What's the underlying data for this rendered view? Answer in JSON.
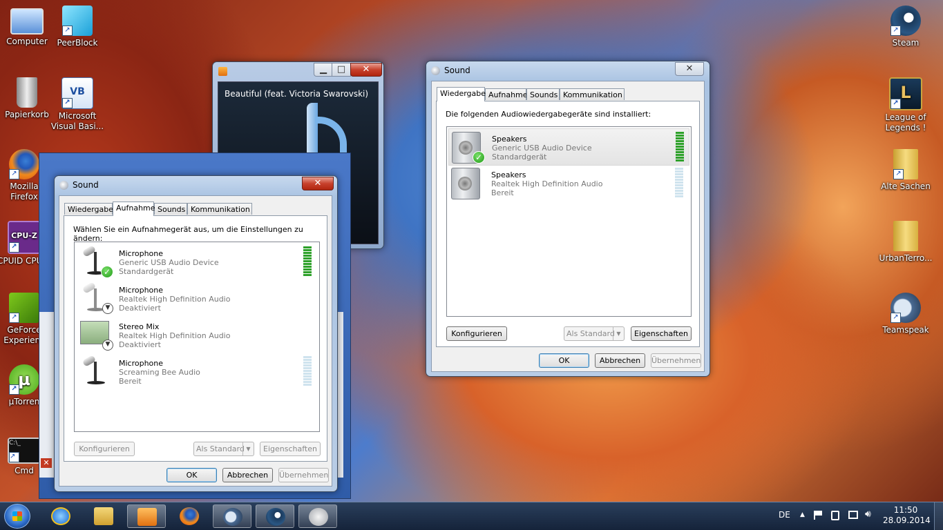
{
  "desktop": {
    "icons_left": [
      {
        "label": "Computer",
        "icon": "computer-icon"
      },
      {
        "label": "PeerBlock",
        "icon": "peerblock-icon"
      },
      {
        "label": "Papierkorb",
        "icon": "recycle-bin-icon"
      },
      {
        "label": "Microsoft Visual Basi...",
        "icon": "visual-basic-icon"
      },
      {
        "label": "Mozilla Firefox",
        "icon": "firefox-icon"
      },
      {
        "label": "CPUID CPU-Z",
        "icon": "cpuz-icon"
      },
      {
        "label": "GeForce Experienc",
        "icon": "geforce-icon"
      },
      {
        "label": "µTorren",
        "icon": "utorrent-icon"
      },
      {
        "label": "Cmd",
        "icon": "cmd-icon"
      }
    ],
    "icons_right": [
      {
        "label": "Steam",
        "icon": "steam-icon"
      },
      {
        "label": "League of Legends !",
        "icon": "league-icon"
      },
      {
        "label": "Alte Sachen",
        "icon": "folder-icon"
      },
      {
        "label": "UrbanTerro...",
        "icon": "folder-icon"
      },
      {
        "label": "Teamspeak",
        "icon": "teamspeak-icon"
      }
    ]
  },
  "media_player": {
    "title": "Beautiful (feat. Victoria Swarovski)"
  },
  "sound_playback": {
    "title": "Sound",
    "tabs": [
      "Wiedergabe",
      "Aufnahme",
      "Sounds",
      "Kommunikation"
    ],
    "selected_tab": "Wiedergabe",
    "instruction": "Die folgenden Audiowiedergabegeräte sind installiert:",
    "devices": [
      {
        "name": "Speakers",
        "line2": "Generic USB Audio Device",
        "line3": "Standardgerät",
        "level": 1.0
      },
      {
        "name": "Speakers",
        "line2": "Realtek High Definition Audio",
        "line3": "Bereit",
        "level": 0.0
      }
    ],
    "btn_configure": "Konfigurieren",
    "btn_default": "Als Standard",
    "btn_properties": "Eigenschaften",
    "btn_ok": "OK",
    "btn_cancel": "Abbrechen",
    "btn_apply": "Übernehmen"
  },
  "sound_recording": {
    "title": "Sound",
    "tabs": [
      "Wiedergabe",
      "Aufnahme",
      "Sounds",
      "Kommunikation"
    ],
    "selected_tab": "Aufnahme",
    "instruction": "Wählen Sie ein Aufnahmegerät aus, um die Einstellungen zu ändern:",
    "devices": [
      {
        "name": "Microphone",
        "line2": "Generic USB Audio Device",
        "line3": "Standardgerät",
        "level": 1.0
      },
      {
        "name": "Microphone",
        "line2": "Realtek High Definition Audio",
        "line3": "Deaktiviert"
      },
      {
        "name": "Stereo Mix",
        "line2": "Realtek High Definition Audio",
        "line3": "Deaktiviert"
      },
      {
        "name": "Microphone",
        "line2": "Screaming Bee Audio",
        "line3": "Bereit",
        "level": 0.0
      }
    ],
    "btn_configure": "Konfigurieren",
    "btn_default": "Als Standard",
    "btn_properties": "Eigenschaften",
    "btn_ok": "OK",
    "btn_cancel": "Abbrechen",
    "btn_apply": "Übernehmen"
  },
  "taskbar": {
    "language": "DE",
    "time": "11:50",
    "date": "28.09.2014"
  },
  "colors": {
    "meter_on": "#2ea12a",
    "meter_off": "#cfe3ee"
  }
}
